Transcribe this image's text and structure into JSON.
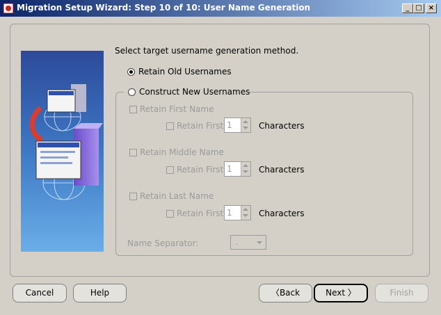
{
  "window": {
    "title": "Migration Setup Wizard:  Step 10 of 10: User Name Generation",
    "controls": {
      "minimize": "_",
      "maximize": "□",
      "close": "×"
    }
  },
  "main": {
    "prompt": "Select target username generation method.",
    "option_retain_old": {
      "label": "Retain Old Usernames",
      "selected": true
    },
    "option_construct_new": {
      "label": "Construct New Usernames",
      "selected": false
    },
    "sections": [
      {
        "label": "Retain First Name",
        "sub_label": "Retain First",
        "value": "1",
        "unit": "Characters"
      },
      {
        "label": "Retain Middle Name",
        "sub_label": "Retain First",
        "value": "1",
        "unit": "Characters"
      },
      {
        "label": "Retain Last Name",
        "sub_label": "Retain First",
        "value": "1",
        "unit": "Characters"
      }
    ],
    "separator_label": "Name Separator:",
    "separator_value": "."
  },
  "footer": {
    "cancel": "Cancel",
    "help": "Help",
    "back": "Back",
    "next": "Next",
    "finish": "Finish"
  },
  "icons": [
    "app-icon",
    "wizard-illustration-icon",
    "chevron-left-icon",
    "chevron-right-icon"
  ]
}
